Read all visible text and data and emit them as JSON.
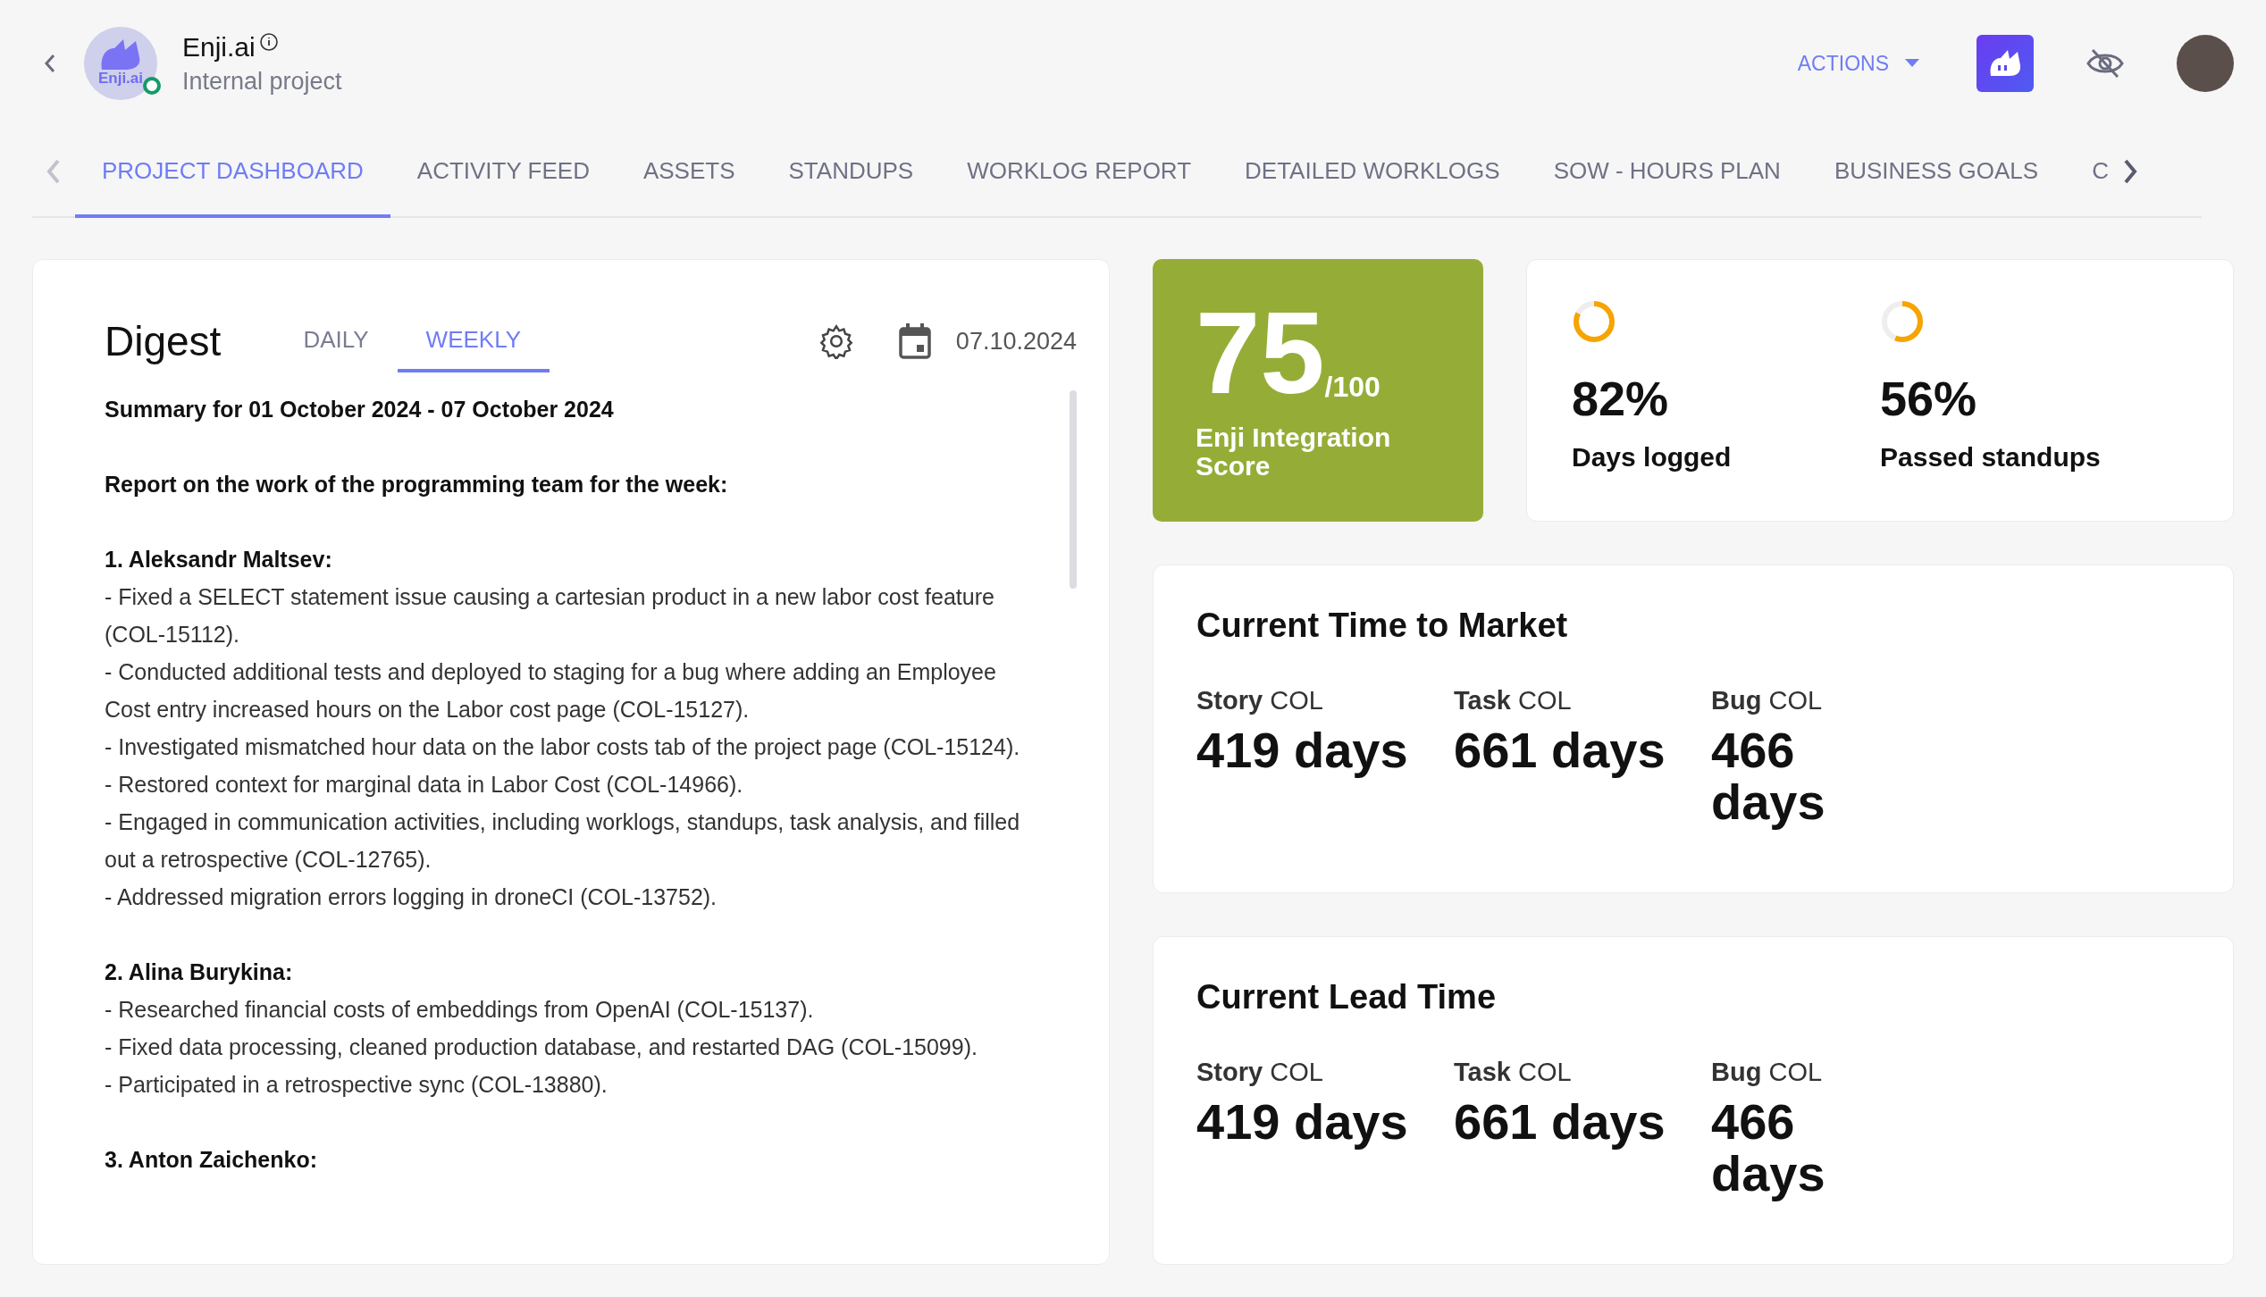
{
  "header": {
    "project_name": "Enji.ai",
    "logo_text": "Enji.ai",
    "online": true,
    "subtitle": "Internal project",
    "actions_label": "ACTIONS"
  },
  "tabs": [
    {
      "label": "PROJECT DASHBOARD",
      "selected": true
    },
    {
      "label": "ACTIVITY FEED",
      "selected": false
    },
    {
      "label": "ASSETS",
      "selected": false
    },
    {
      "label": "STANDUPS",
      "selected": false
    },
    {
      "label": "WORKLOG REPORT",
      "selected": false
    },
    {
      "label": "DETAILED WORKLOGS",
      "selected": false
    },
    {
      "label": "SOW - HOURS PLAN",
      "selected": false
    },
    {
      "label": "BUSINESS GOALS",
      "selected": false
    },
    {
      "label": "C",
      "selected": false
    }
  ],
  "digest": {
    "title": "Digest",
    "tabs": [
      {
        "label": "DAILY",
        "selected": false
      },
      {
        "label": "WEEKLY",
        "selected": true
      }
    ],
    "date": "07.10.2024",
    "summary": "Summary for 01 October 2024 - 07 October 2024",
    "intro": "Report on the work of the programming team for the week:",
    "sections": [
      {
        "name": "1. Aleksandr Maltsev:",
        "items": [
          "- Fixed a SELECT statement issue causing a cartesian product in a new labor cost feature (COL-15112).",
          "- Conducted additional tests and deployed to staging for a bug where adding an Employee Cost entry increased hours on the Labor cost page (COL-15127).",
          "- Investigated mismatched hour data on the labor costs tab of the project page (COL-15124).",
          "- Restored context for marginal data in Labor Cost (COL-14966).",
          "- Engaged in communication activities, including worklogs, standups, task analysis, and filled out a retrospective (COL-12765).",
          "- Addressed migration errors logging in droneCI (COL-13752)."
        ]
      },
      {
        "name": "2. Alina Burykina:",
        "items": [
          "- Researched financial costs of embeddings from OpenAI (COL-15137).",
          "- Fixed data processing, cleaned production database, and restarted DAG (COL-15099).",
          "- Participated in a retrospective sync (COL-13880)."
        ]
      },
      {
        "name": "3. Anton Zaichenko:"
      }
    ]
  },
  "score": {
    "value": "75",
    "max": "/100",
    "label": "Enji Integration Score"
  },
  "stats": [
    {
      "value": "82%",
      "label": "Days logged",
      "level": 0.82
    },
    {
      "value": "56%",
      "label": "Passed standups",
      "level": 0.56
    }
  ],
  "metric_cards": [
    {
      "title": "Current Time to Market",
      "metrics": [
        {
          "type": "Story",
          "project": "COL",
          "value": "419 days"
        },
        {
          "type": "Task",
          "project": "COL",
          "value": "661 days"
        },
        {
          "type": "Bug",
          "project": "COL",
          "value": "466 days"
        }
      ]
    },
    {
      "title": "Current Lead Time",
      "metrics": [
        {
          "type": "Story",
          "project": "COL",
          "value": "419 days"
        },
        {
          "type": "Task",
          "project": "COL",
          "value": "661 days"
        },
        {
          "type": "Bug",
          "project": "COL",
          "value": "466 days"
        }
      ]
    }
  ]
}
